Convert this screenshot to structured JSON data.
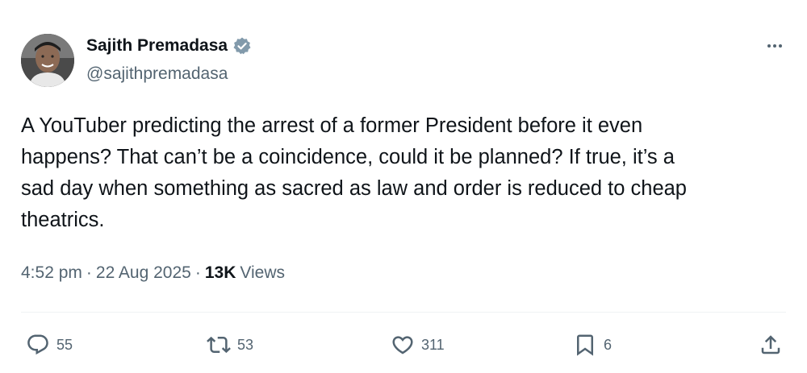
{
  "author": {
    "display_name": "Sajith Premadasa",
    "handle": "@sajithpremadasa",
    "verified": true
  },
  "tweet": {
    "text": "A YouTuber predicting the arrest of a former President before it even\nhappens? That can’t be a coincidence, could it be planned? If true, it’s a\nsad day when something as sacred as law and order is reduced to cheap\ntheatrics.",
    "time": "4:52 pm",
    "date": "22 Aug 2025",
    "views_count": "13K",
    "views_label": "Views",
    "separator": "·"
  },
  "actions": {
    "replies": "55",
    "reposts": "53",
    "likes": "311",
    "bookmarks": "6"
  },
  "colors": {
    "primary_text": "#0f1419",
    "secondary_text": "#536471",
    "verified_badge": "#829aab",
    "divider": "#eff3f4"
  },
  "icons": {
    "more": "more-horizontal-icon",
    "reply": "reply-icon",
    "repost": "repost-icon",
    "like": "heart-icon",
    "bookmark": "bookmark-icon",
    "share": "share-icon",
    "verified": "verified-badge-icon"
  }
}
